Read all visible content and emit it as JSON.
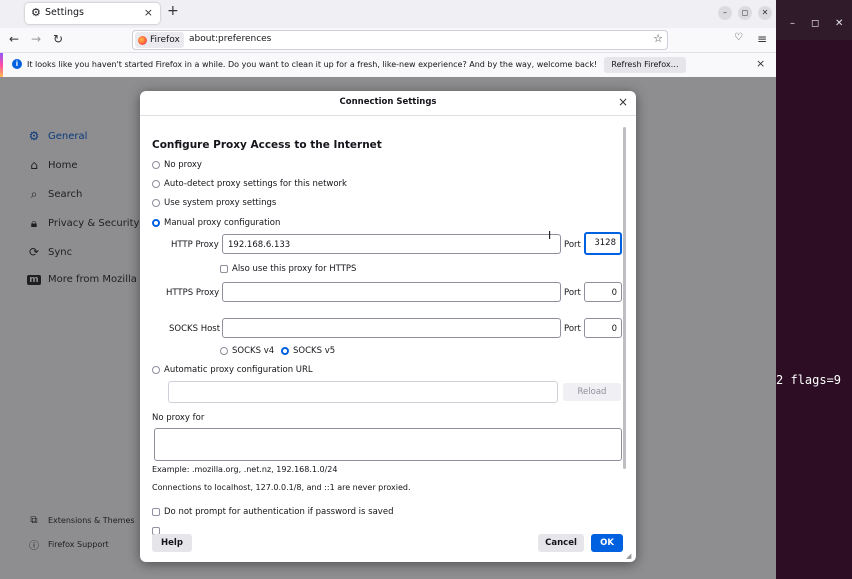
{
  "browser": {
    "tab_title": "Settings",
    "tab_close": "×",
    "new_tab": "+",
    "identity_label": "Firefox",
    "url": "about:preferences",
    "window_controls": [
      "–",
      "◻",
      "✕"
    ]
  },
  "notification": {
    "message": "It looks like you haven't started Firefox in a while. Do you want to clean it up for a fresh, like-new experience? And by the way, welcome back!",
    "button": "Refresh Firefox…",
    "close": "×"
  },
  "sidebar": {
    "items": [
      {
        "label": "General",
        "icon": "gear-icon"
      },
      {
        "label": "Home",
        "icon": "home-icon"
      },
      {
        "label": "Search",
        "icon": "search-icon"
      },
      {
        "label": "Privacy & Security",
        "icon": "lock-icon"
      },
      {
        "label": "Sync",
        "icon": "sync-icon"
      },
      {
        "label": "More from Mozilla",
        "icon": "mozilla-icon"
      }
    ],
    "footer": [
      {
        "label": "Extensions & Themes",
        "icon": "puzzle-icon"
      },
      {
        "label": "Firefox Support",
        "icon": "help-icon"
      }
    ]
  },
  "terminal": {
    "text": "2 flags=9",
    "controls": [
      "–",
      "◻",
      "✕"
    ]
  },
  "dialog": {
    "title": "Connection Settings",
    "close": "×",
    "heading": "Configure Proxy Access to the Internet",
    "options": {
      "no_proxy": "No proxy",
      "auto_detect": "Auto-detect proxy settings for this network",
      "system": "Use system proxy settings",
      "manual": "Manual proxy configuration",
      "auto_url": "Automatic proxy configuration URL"
    },
    "selected_option": "manual",
    "http": {
      "label": "HTTP Proxy",
      "value": "192.168.6.133",
      "port_label": "Port",
      "port": "3128"
    },
    "also_https": "Also use this proxy for HTTPS",
    "https": {
      "label": "HTTPS Proxy",
      "value": "",
      "port_label": "Port",
      "port": "0"
    },
    "socks": {
      "label": "SOCKS Host",
      "value": "",
      "port_label": "Port",
      "port": "0",
      "v4": "SOCKS v4",
      "v5": "SOCKS v5",
      "selected": "v5"
    },
    "reload": "Reload",
    "no_proxy_for": "No proxy for",
    "example": "Example: .mozilla.org, .net.nz, 192.168.1.0/24",
    "localhost_note": "Connections to localhost, 127.0.0.1/8, and ::1 are never proxied.",
    "no_prompt_auth": "Do not prompt for authentication if password is saved",
    "help": "Help",
    "cancel": "Cancel",
    "ok": "OK"
  }
}
